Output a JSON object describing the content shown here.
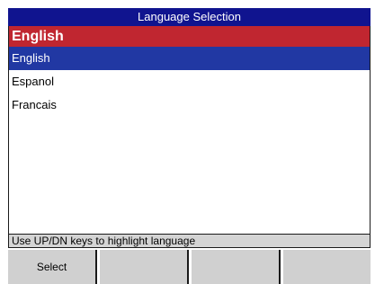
{
  "window": {
    "title": "Language Selection"
  },
  "current_language": "English",
  "languages": [
    {
      "label": "English",
      "selected": true
    },
    {
      "label": "Espanol",
      "selected": false
    },
    {
      "label": "Francais",
      "selected": false
    }
  ],
  "status": {
    "hint": "Use UP/DN keys to highlight language"
  },
  "softkeys": [
    {
      "label": "Select"
    },
    {
      "label": ""
    },
    {
      "label": ""
    },
    {
      "label": ""
    }
  ],
  "colors": {
    "title_bg": "#10148f",
    "current_bg": "#c02630",
    "highlight_bg": "#2138a3",
    "softkey_bg": "#d0d0d0",
    "status_bg": "#d4d4d4"
  }
}
